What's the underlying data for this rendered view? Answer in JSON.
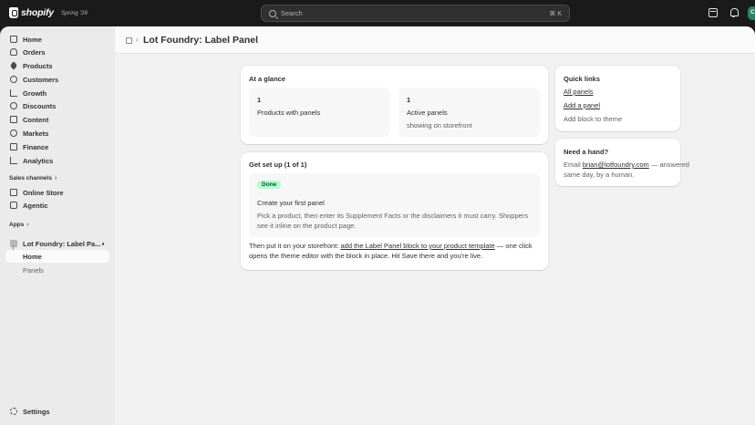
{
  "topbar": {
    "brand": "shopify",
    "edition": "Spring '26",
    "search_placeholder": "Search",
    "shortcut": "⌘ K",
    "avatar_initials": "C"
  },
  "sidebar": {
    "items": [
      {
        "label": "Home",
        "icon": "home-icon"
      },
      {
        "label": "Orders",
        "icon": "orders-icon"
      },
      {
        "label": "Products",
        "icon": "products-icon"
      },
      {
        "label": "Customers",
        "icon": "customers-icon"
      },
      {
        "label": "Growth",
        "icon": "growth-icon"
      },
      {
        "label": "Discounts",
        "icon": "discounts-icon"
      },
      {
        "label": "Content",
        "icon": "content-icon"
      },
      {
        "label": "Markets",
        "icon": "markets-icon"
      },
      {
        "label": "Finance",
        "icon": "finance-icon"
      },
      {
        "label": "Analytics",
        "icon": "analytics-icon"
      }
    ],
    "sales_channels_label": "Sales channels",
    "channels": [
      {
        "label": "Online Store"
      },
      {
        "label": "Agentic"
      }
    ],
    "apps_label": "Apps",
    "app_name": "Lot Foundry: Label Pa...",
    "app_subitems": [
      {
        "label": "Home",
        "active": true
      },
      {
        "label": "Panels",
        "active": false
      }
    ],
    "settings_label": "Settings"
  },
  "header": {
    "title": "Lot Foundry: Label Panel"
  },
  "glance": {
    "title": "At a glance",
    "stats": [
      {
        "value": "1",
        "label": "Products with panels",
        "sub": ""
      },
      {
        "value": "1",
        "label": "Active panels",
        "sub": "showing on storefront"
      }
    ]
  },
  "setup": {
    "title": "Get set up (1 of 1)",
    "badge": "Done",
    "step_title": "Create your first panel",
    "step_text": "Pick a product, then enter its Supplement Facts or the disclaimers it must carry. Shoppers see it inline on the product page.",
    "after_prefix": "Then put it on your storefront: ",
    "after_link": "add the Label Panel block to your product template",
    "after_suffix": " — one click opens the theme editor with the block in place. Hit Save there and you're live."
  },
  "quick_links": {
    "title": "Quick links",
    "links": [
      {
        "label": "All panels"
      },
      {
        "label": "Add a panel"
      },
      {
        "label": "Add block to theme"
      }
    ]
  },
  "help": {
    "title": "Need a hand?",
    "prefix": "Email ",
    "email": "brian@lotfoundry.com",
    "suffix": " — answered same day, by a human."
  },
  "colors": {
    "done_badge_bg": "#b4fed2",
    "topbar_bg": "#1a1a1a",
    "avatar_bg": "#29845a"
  }
}
